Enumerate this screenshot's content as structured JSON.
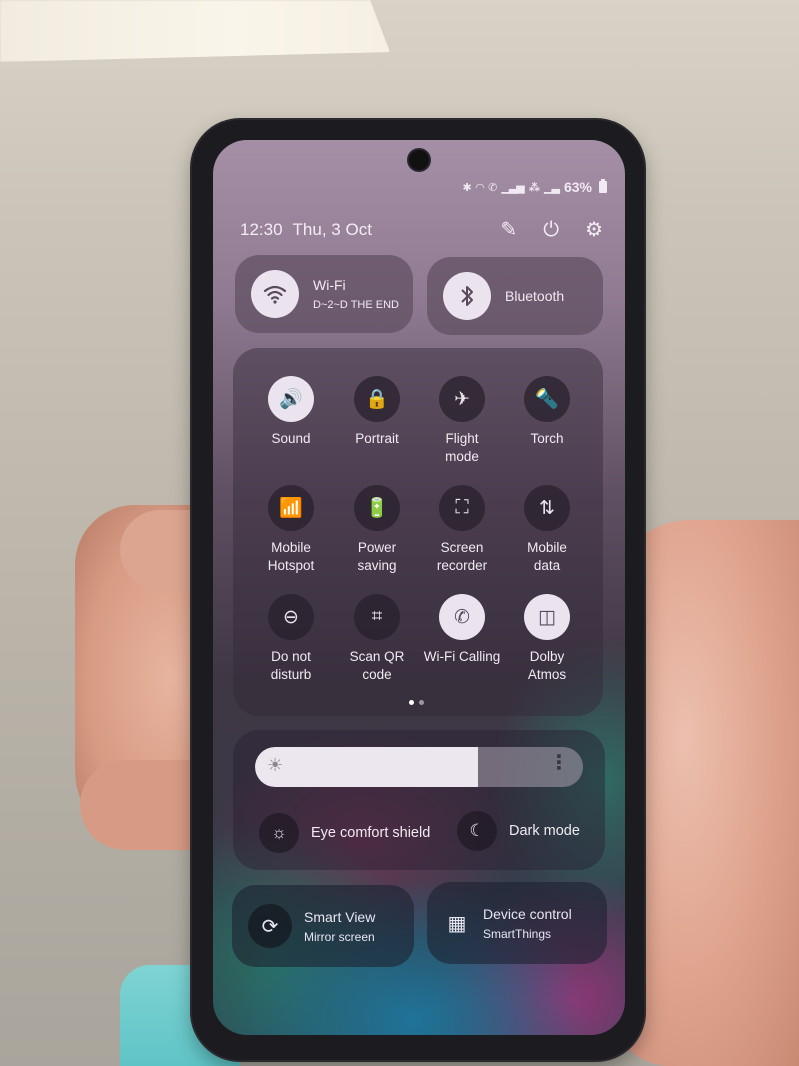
{
  "status_bar": {
    "icons": [
      "bluetooth-icon",
      "wifi-icon",
      "wifi-calling-icon",
      "signal-icon",
      "volte-icon",
      "signal-icon-2"
    ],
    "battery": "63%"
  },
  "header": {
    "time": "12:30",
    "date": "Thu, 3 Oct",
    "actions": [
      {
        "name": "edit-button",
        "icon": "✎"
      },
      {
        "name": "power-button",
        "icon": "⏻"
      },
      {
        "name": "settings-button",
        "icon": "⚙"
      }
    ]
  },
  "wifi_tile": {
    "title": "Wi-Fi",
    "subtitle": "D~2~D THE END",
    "state": "on"
  },
  "bluetooth_tile": {
    "title": "Bluetooth",
    "state": "on"
  },
  "quick_settings": [
    {
      "label": "Sound",
      "icon": "🔊",
      "state": "on"
    },
    {
      "label": "Portrait",
      "icon": "🔒",
      "state": "off"
    },
    {
      "label": "Flight mode",
      "icon": "✈",
      "state": "off"
    },
    {
      "label": "Torch",
      "icon": "🔦",
      "state": "off"
    },
    {
      "label": "Mobile Hotspot",
      "icon": "📶",
      "state": "off"
    },
    {
      "label": "Power saving",
      "icon": "🔋",
      "state": "off"
    },
    {
      "label": "Screen recorder",
      "icon": "⛶",
      "state": "off"
    },
    {
      "label": "Mobile data",
      "icon": "⇅",
      "state": "off"
    },
    {
      "label": "Do not disturb",
      "icon": "⊖",
      "state": "off"
    },
    {
      "label": "Scan QR code",
      "icon": "⌗",
      "state": "off"
    },
    {
      "label": "Wi-Fi Calling",
      "icon": "✆",
      "state": "on"
    },
    {
      "label": "Dolby Atmos",
      "icon": "◫",
      "state": "on"
    }
  ],
  "pager": {
    "pages": 2,
    "current": 1
  },
  "brightness": {
    "level_percent": 68,
    "sun_icon": "☀",
    "more_icon": "⋮"
  },
  "eye_comfort": {
    "label": "Eye comfort shield",
    "icon": "☼",
    "state": "off"
  },
  "dark_mode": {
    "label": "Dark mode",
    "icon": "☾",
    "state": "off"
  },
  "smart_view": {
    "title": "Smart View",
    "subtitle": "Mirror screen",
    "icon": "⟳"
  },
  "device_control": {
    "title": "Device control",
    "subtitle": "SmartThings",
    "icon": "▦"
  }
}
